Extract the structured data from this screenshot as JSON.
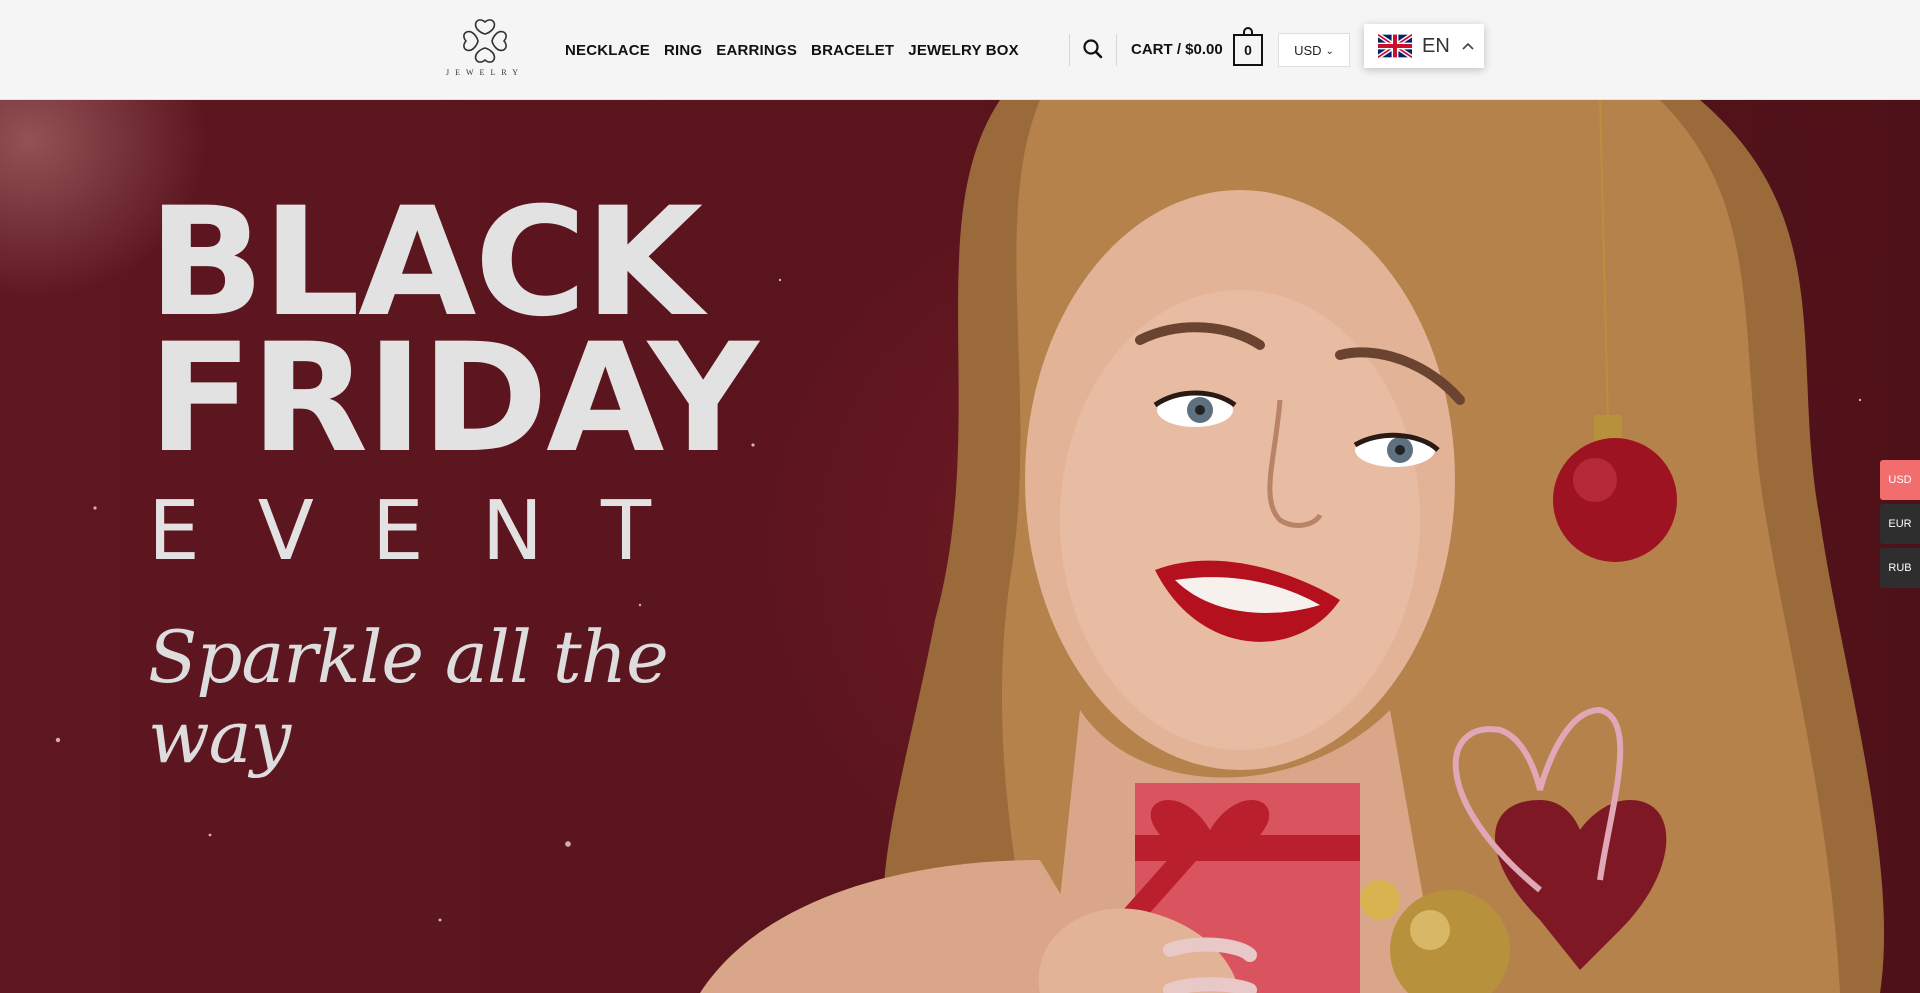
{
  "header": {
    "logo_text": "JEWELRY",
    "nav": [
      "NECKLACE",
      "RING",
      "EARRINGS",
      "BRACELET",
      "JEWELRY BOX"
    ],
    "cart_label": "CART / $0.00",
    "cart_count": "0",
    "currency_selected": "USD",
    "language_selected": "EN",
    "icons": {
      "search": "search-icon",
      "currency_chevron": "chevron-down-icon",
      "language_flag": "uk-flag-icon",
      "language_chevron": "chevron-up-icon"
    }
  },
  "hero": {
    "headline_line1": "BLACK",
    "headline_line2": "FRIDAY",
    "event_word": "EVENT",
    "tagline": "Sparkle all the way"
  },
  "side_currency": [
    {
      "code": "USD",
      "color": "#f26d6d"
    },
    {
      "code": "EUR",
      "color": "#2e2e2e"
    },
    {
      "code": "RUB",
      "color": "#2e2e2e"
    }
  ],
  "colors": {
    "header_bg": "#f5f5f5",
    "hero_bg": "#5a141c",
    "active_currency": "#f26d6d",
    "headline_text": "#e2e2e2"
  }
}
